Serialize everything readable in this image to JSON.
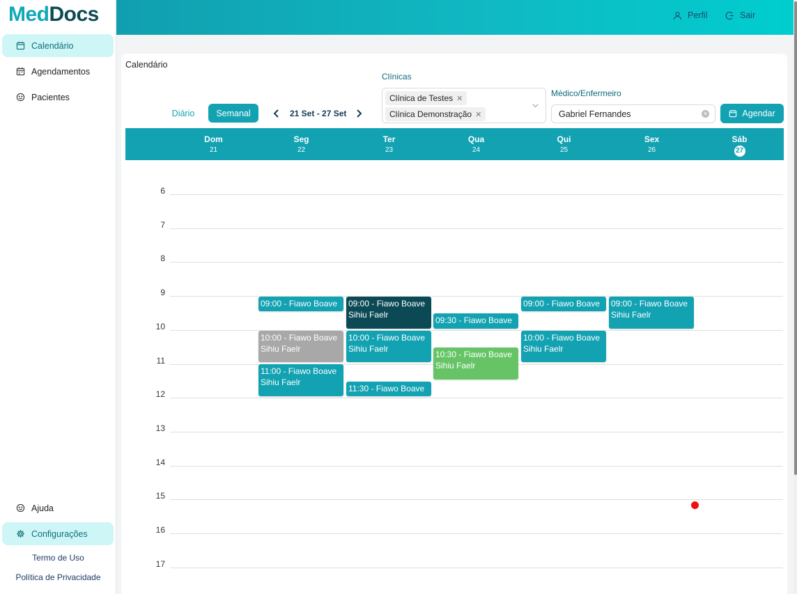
{
  "app": {
    "logo_part1": "Med",
    "logo_part2": "Docs"
  },
  "sidebar": {
    "items": [
      {
        "label": "Calendário",
        "icon": "calendar-icon",
        "active": true
      },
      {
        "label": "Agendamentos",
        "icon": "calendar-list-icon",
        "active": false
      },
      {
        "label": "Pacientes",
        "icon": "smile-icon",
        "active": false
      }
    ],
    "bottom_items": [
      {
        "label": "Ajuda",
        "icon": "smile-icon",
        "active": false
      },
      {
        "label": "Configurações",
        "icon": "gear-icon",
        "active": true
      }
    ],
    "footer_links": [
      "Termo de Uso",
      "Política de Privacidade"
    ]
  },
  "topbar": {
    "profile_label": "Perfil",
    "logout_label": "Sair"
  },
  "page": {
    "title": "Calendário",
    "view_daily": "Diário",
    "view_weekly": "Semanal",
    "active_view": "Semanal",
    "date_range": "21 Set - 27 Set",
    "clinics_label": "Clínicas",
    "clinics_selected": [
      "Clínica de Testes",
      "Clínica Demonstração"
    ],
    "professional_label": "Médico/Enfermeiro",
    "professional_value": "Gabriel Fernandes",
    "schedule_button": "Agendar"
  },
  "calendar": {
    "days": [
      {
        "name": "Dom",
        "date": "21"
      },
      {
        "name": "Seg",
        "date": "22"
      },
      {
        "name": "Ter",
        "date": "23"
      },
      {
        "name": "Qua",
        "date": "24"
      },
      {
        "name": "Qui",
        "date": "25"
      },
      {
        "name": "Sex",
        "date": "26"
      },
      {
        "name": "Sáb",
        "date": "27",
        "today": true
      }
    ],
    "hours": [
      "6",
      "7",
      "8",
      "9",
      "10",
      "11",
      "12",
      "13",
      "14",
      "15",
      "16",
      "17"
    ],
    "events": [
      {
        "day": 1,
        "start": 9.0,
        "end": 9.5,
        "line1": "09:00 - Fiawo Boave",
        "line2": "",
        "color": "#12a2b2"
      },
      {
        "day": 1,
        "start": 10.0,
        "end": 11.0,
        "line1": "10:00 - Fiawo Boave",
        "line2": "Sihiu Faelr",
        "color": "#a8a8a8"
      },
      {
        "day": 1,
        "start": 11.0,
        "end": 12.0,
        "line1": "11:00 - Fiawo Boave",
        "line2": "Sihiu Faelr",
        "color": "#12a2b2"
      },
      {
        "day": 2,
        "start": 9.0,
        "end": 10.0,
        "line1": "09:00 - Fiawo Boave",
        "line2": "Sihiu Faelr",
        "color": "#0b4a55"
      },
      {
        "day": 2,
        "start": 10.0,
        "end": 11.0,
        "line1": "10:00 - Fiawo Boave",
        "line2": "Sihiu Faelr",
        "color": "#12a2b2"
      },
      {
        "day": 2,
        "start": 11.5,
        "end": 12.0,
        "line1": "11:30 - Fiawo Boave",
        "line2": "",
        "color": "#12a2b2"
      },
      {
        "day": 3,
        "start": 9.5,
        "end": 10.0,
        "line1": "09:30 - Fiawo Boave",
        "line2": "",
        "color": "#12a2b2"
      },
      {
        "day": 3,
        "start": 10.5,
        "end": 11.5,
        "line1": "10:30 - Fiawo Boave",
        "line2": "Sihiu Faelr",
        "color": "#66c466"
      },
      {
        "day": 4,
        "start": 9.0,
        "end": 9.5,
        "line1": "09:00 - Fiawo Boave",
        "line2": "",
        "color": "#12a2b2"
      },
      {
        "day": 4,
        "start": 10.0,
        "end": 11.0,
        "line1": "10:00 - Fiawo Boave",
        "line2": "Sihiu Faelr",
        "color": "#12a2b2"
      },
      {
        "day": 5,
        "start": 9.0,
        "end": 10.0,
        "line1": "09:00 - Fiawo Boave",
        "line2": "Sihiu Faelr",
        "color": "#12a2b2"
      }
    ],
    "now_indicator_color": "#ee1111"
  },
  "colors": {
    "accent": "#12a2b2",
    "dark_teal": "#0b4a55",
    "active_bg": "#cff6f7"
  }
}
